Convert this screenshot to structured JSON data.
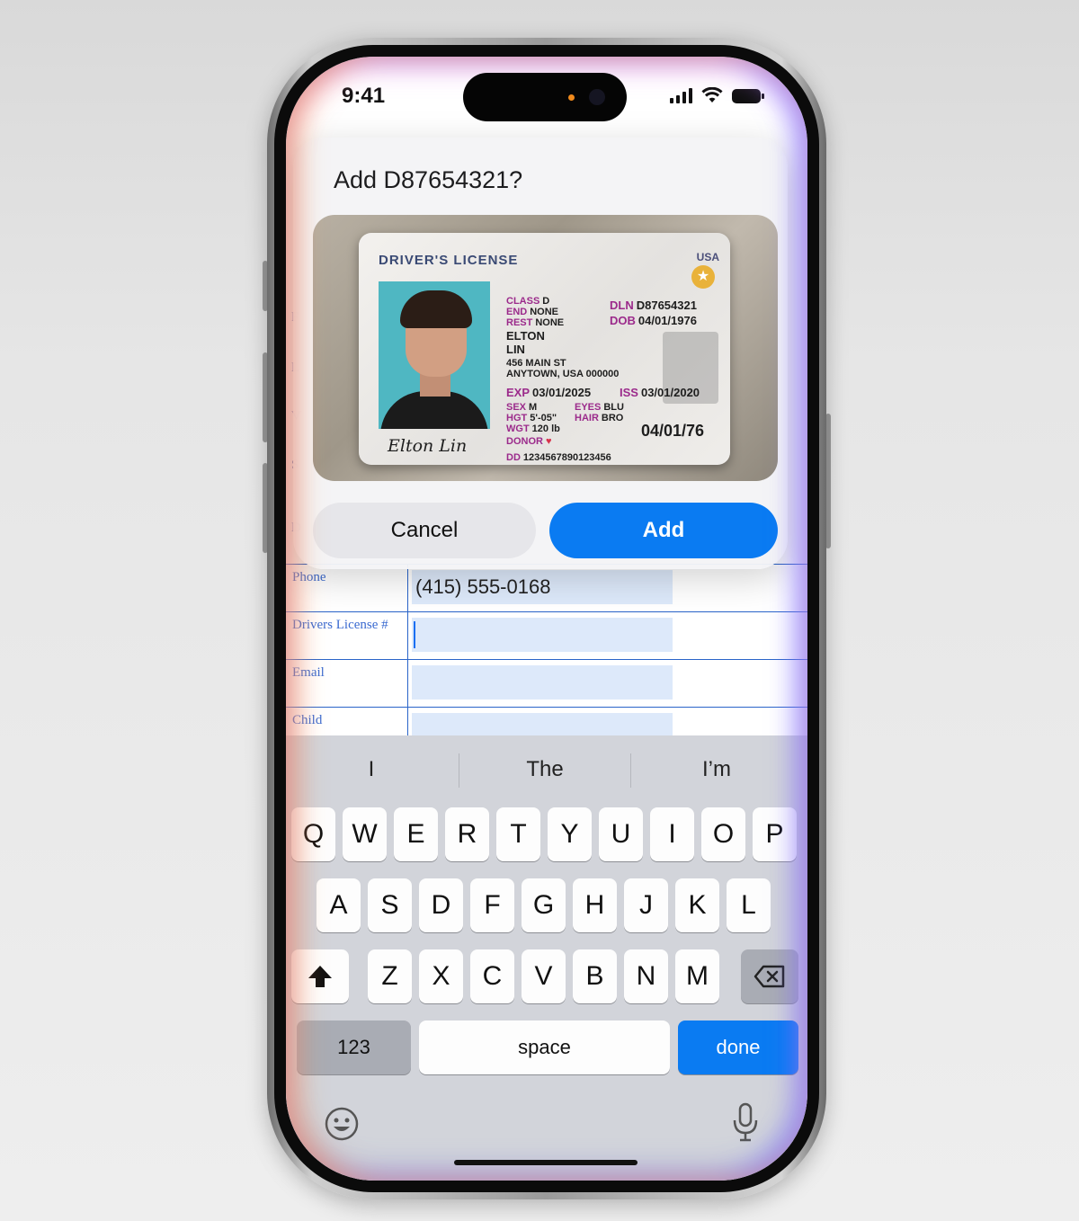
{
  "status_bar": {
    "time": "9:41"
  },
  "sheet": {
    "title": "Add D87654321?",
    "cancel_label": "Cancel",
    "add_label": "Add"
  },
  "license": {
    "title": "DRIVER'S LICENSE",
    "country": "USA",
    "class_key": "CLASS",
    "class_val": "D",
    "end_key": "END",
    "end_val": "NONE",
    "rest_key": "REST",
    "rest_val": "NONE",
    "dln_key": "DLN",
    "dln_val": "D87654321",
    "dob_key": "DOB",
    "dob_val": "04/01/1976",
    "first_name": "ELTON",
    "last_name": "LIN",
    "address1": "456 MAIN ST",
    "address2": "ANYTOWN, USA 000000",
    "exp_key": "EXP",
    "exp_val": "03/01/2025",
    "iss_key": "ISS",
    "iss_val": "03/01/2020",
    "sex_key": "SEX",
    "sex_val": "M",
    "eyes_key": "EYES",
    "eyes_val": "BLU",
    "hgt_key": "HGT",
    "hgt_val": "5'-05\"",
    "hair_key": "HAIR",
    "hair_val": "BRO",
    "wgt_key": "WGT",
    "wgt_val": "120 lb",
    "donor_key": "DONOR",
    "dd_key": "DD",
    "dd_val": "1234567890123456",
    "dob_short": "04/01/76",
    "signature": "Elton Lin"
  },
  "form": {
    "phone_label": "Phone",
    "phone_value": "(415) 555-0168",
    "license_label": "Drivers License #",
    "email_label": "Email",
    "child_label": "Child"
  },
  "keyboard": {
    "suggestions": [
      "I",
      "The",
      "I’m"
    ],
    "row1": [
      "Q",
      "W",
      "E",
      "R",
      "T",
      "Y",
      "U",
      "I",
      "O",
      "P"
    ],
    "row2": [
      "A",
      "S",
      "D",
      "F",
      "G",
      "H",
      "J",
      "K",
      "L"
    ],
    "row3": [
      "Z",
      "X",
      "C",
      "V",
      "B",
      "N",
      "M"
    ],
    "numbers_label": "123",
    "space_label": "space",
    "done_label": "done"
  },
  "icons": {
    "shift": "shift-icon",
    "delete": "delete-icon",
    "emoji": "emoji-icon",
    "microphone": "microphone-icon"
  },
  "colors": {
    "accent": "#0a7bf2",
    "form_line": "#2a64c9",
    "field_fill": "#dde9fa"
  }
}
